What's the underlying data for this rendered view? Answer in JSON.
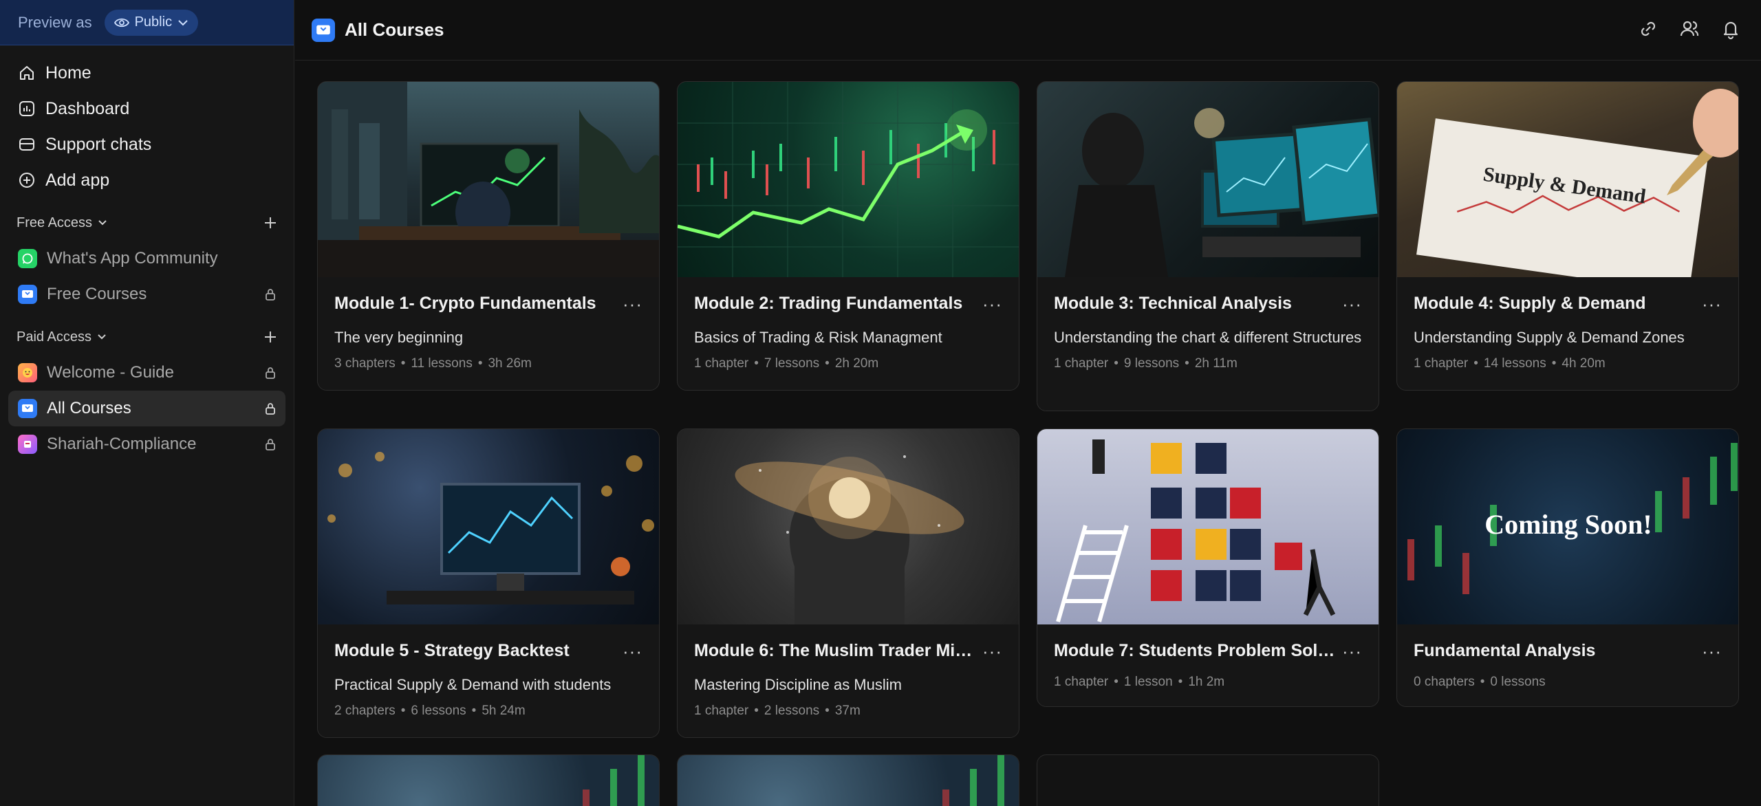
{
  "preview": {
    "label": "Preview as",
    "mode": "Public"
  },
  "nav": [
    {
      "label": "Home",
      "icon": "home-icon"
    },
    {
      "label": "Dashboard",
      "icon": "dashboard-icon"
    },
    {
      "label": "Support chats",
      "icon": "chat-icon"
    },
    {
      "label": "Add app",
      "icon": "add-circle-icon"
    }
  ],
  "free_access": {
    "title": "Free Access",
    "items": [
      {
        "label": "What's App Community",
        "icon": "whatsapp-icon"
      },
      {
        "label": "Free Courses",
        "icon": "courses-icon"
      }
    ]
  },
  "paid_access": {
    "title": "Paid Access",
    "items": [
      {
        "label": "Welcome - Guide",
        "icon": "smiley-icon"
      },
      {
        "label": "All Courses",
        "icon": "courses-icon"
      },
      {
        "label": "Shariah-Compliance",
        "icon": "app-icon"
      }
    ]
  },
  "header": {
    "title": "All Courses"
  },
  "courses": [
    {
      "title": "Module 1- Crypto Fundamentals",
      "desc": "The very beginning",
      "chapters": "3 chapters",
      "lessons": "11 lessons",
      "duration": "3h 26m"
    },
    {
      "title": "Module 2: Trading Fundamentals",
      "desc": "Basics of Trading & Risk Managment",
      "chapters": "1 chapter",
      "lessons": "7 lessons",
      "duration": "2h 20m"
    },
    {
      "title": "Module 3: Technical Analysis",
      "desc": "Understanding the chart & different Structures",
      "chapters": "1 chapter",
      "lessons": "9 lessons",
      "duration": "2h 11m"
    },
    {
      "title": "Module 4: Supply & Demand",
      "desc": "Understanding Supply & Demand Zones",
      "chapters": "1 chapter",
      "lessons": "14 lessons",
      "duration": "4h 20m",
      "thumb_text": "Supply & Demand"
    },
    {
      "title": "Module 5 - Strategy Backtest",
      "desc": "Practical Supply & Demand with students",
      "chapters": "2 chapters",
      "lessons": "6 lessons",
      "duration": "5h 24m"
    },
    {
      "title": "Module 6: The Muslim Trader Mi…",
      "desc": "Mastering Discipline as Muslim",
      "chapters": "1 chapter",
      "lessons": "2 lessons",
      "duration": "37m"
    },
    {
      "title": "Module 7: Students Problem Solv…",
      "desc": "",
      "chapters": "1 chapter",
      "lessons": "1 lesson",
      "duration": "1h 2m"
    },
    {
      "title": "Fundamental Analysis",
      "desc": "",
      "chapters": "0 chapters",
      "lessons": "0 lessons",
      "duration": "",
      "thumb_text": "Coming Soon!"
    }
  ],
  "colors": {
    "accent": "#2f7bf5",
    "whatsapp": "#25d366",
    "preview_bg": "#13264d"
  }
}
